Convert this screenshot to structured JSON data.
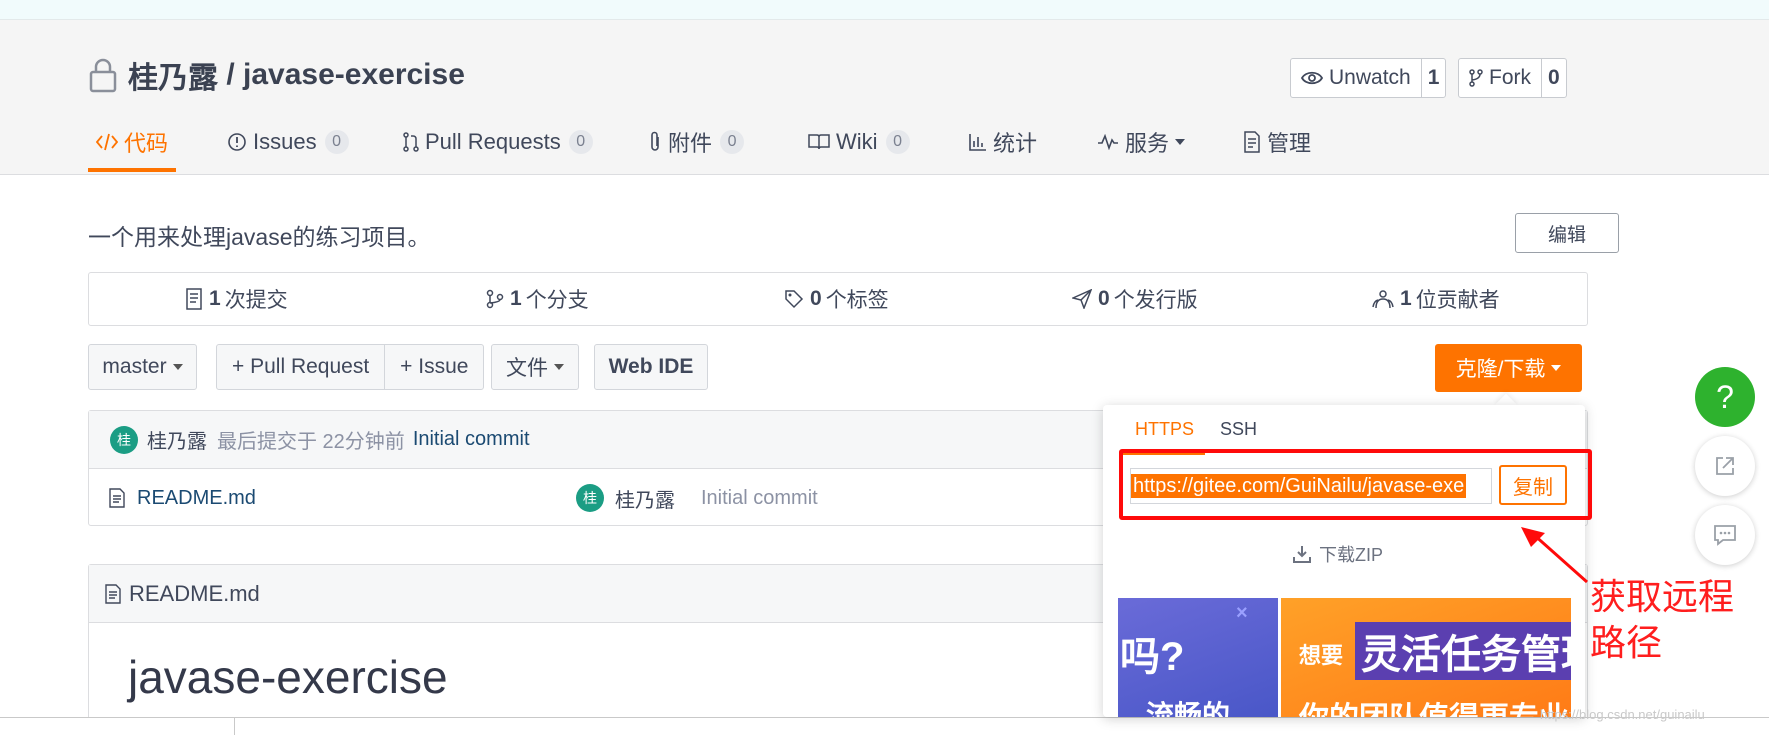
{
  "repo": {
    "owner": "桂乃露",
    "sep": " / ",
    "name": "javase-exercise"
  },
  "header_buttons": {
    "unwatch": {
      "label": "Unwatch",
      "count": "1"
    },
    "fork": {
      "label": "Fork",
      "count": "0"
    }
  },
  "tabs": [
    {
      "label": "代码",
      "icon": "code-icon"
    },
    {
      "label": "Issues",
      "badge": "0",
      "icon": "issue-icon"
    },
    {
      "label": "Pull Requests",
      "badge": "0",
      "icon": "pull-request-icon"
    },
    {
      "label": "附件",
      "badge": "0",
      "icon": "paperclip-icon"
    },
    {
      "label": "Wiki",
      "badge": "0",
      "icon": "book-icon"
    },
    {
      "label": "统计",
      "icon": "bar-chart-icon"
    },
    {
      "label": "服务",
      "icon": "pulse-icon"
    },
    {
      "label": "管理",
      "icon": "settings-doc-icon"
    }
  ],
  "description": "一个用来处理javase的练习项目。",
  "edit_label": "编辑",
  "stats": [
    {
      "num": "1",
      "label": "次提交",
      "icon": "commit-icon"
    },
    {
      "num": "1",
      "label": "个分支",
      "icon": "branch-icon"
    },
    {
      "num": "0",
      "label": "个标签",
      "icon": "tag-icon"
    },
    {
      "num": "0",
      "label": "个发行版",
      "icon": "release-icon"
    },
    {
      "num": "1",
      "label": "位贡献者",
      "icon": "contributors-icon"
    }
  ],
  "toolbar": {
    "branch": "master",
    "pull_request": "+ Pull Request",
    "issue": "+ Issue",
    "file": "文件",
    "web_ide": "Web IDE",
    "clone": "克隆/下载"
  },
  "last_commit": {
    "avatar": "桂",
    "author": "桂乃露",
    "text": "最后提交于 22分钟前",
    "message": "Initial commit"
  },
  "files": [
    {
      "name": "README.md",
      "avatar": "桂",
      "author": "桂乃露",
      "message": "Initial commit"
    }
  ],
  "readme": {
    "header": "README.md",
    "title": "javase-exercise"
  },
  "clone_popup": {
    "tab_https": "HTTPS",
    "tab_ssh": "SSH",
    "url": "https://gitee.com/GuiNailu/javase-exe",
    "copy": "复制",
    "download_zip": "下载ZIP",
    "ad1_line1": "吗?",
    "ad1_x": "×",
    "ad1_line2": "、流畅的",
    "ad2_small": "想要",
    "ad2_big": "灵活任务管理",
    "ad2_sub": "你的团队值得更专业"
  },
  "annotation": {
    "line1": "获取远程",
    "line2": "路径"
  },
  "fab": {
    "help": "?"
  },
  "watermark": "https://blog.csdn.net/guinailu",
  "colors": {
    "accent": "#fe7300",
    "annotation": "#ff0a0a",
    "help_button": "#2eb22e",
    "avatar": "#1b9d84"
  }
}
